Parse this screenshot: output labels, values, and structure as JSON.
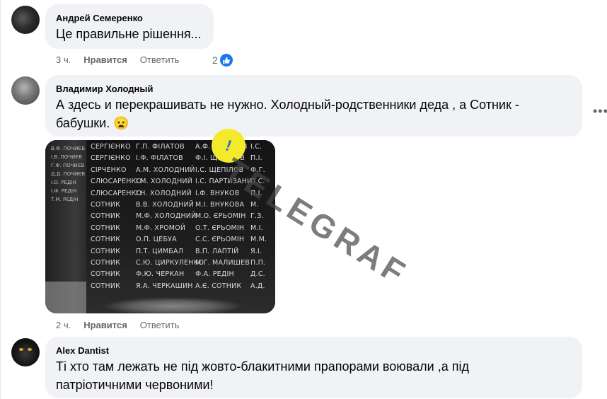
{
  "comments": [
    {
      "author": "Андрей Семеренко",
      "text": "Це правильне рішення...",
      "time": "3 ч.",
      "like_label": "Нравится",
      "reply_label": "Ответить",
      "reaction_count": "2"
    },
    {
      "author": "Владимир Холодный",
      "text_line1": "А здесь и перекрашивать не нужно. Холодный-родственники деда , а Сотник -",
      "text_line2": "бабушки. 😦",
      "time": "2 ч.",
      "like_label": "Нравится",
      "reply_label": "Ответить",
      "more_label": "•••",
      "photo": {
        "watermark": "TELEGRAF",
        "left_names": [
          "В.Ф. ПОЧИЄВ",
          "І.В. ПОЧИЄВ",
          "Г.Ф. ПОЧИЄВ",
          "Д.Д. ПОЧИЄВ",
          "І.О. РЕДІН",
          "І.Ф. РЕДІН",
          "Т.М. РЕДІН"
        ],
        "rows": [
          [
            "СЕРГІЄНКО",
            "Г.П. ФІЛАТОВ",
            "А.Ф. ЩЕПІЛОВ",
            "І.С."
          ],
          [
            "СЕРГІЄНКО",
            "І.Ф. ФІЛАТОВ",
            "Ф.І. ЩЕПІЛОВ",
            "П.І."
          ],
          [
            "СІРЧЕНКО",
            "А.М. ХОЛОДНИЙ",
            "І.С. ЩЕПІЛОВ",
            "Ф.Г."
          ],
          [
            "СЛЮСАРЕНКО",
            "І.М. ХОЛОДНИЙ",
            "І.С. ПАРТИЗАНИ",
            "П.С."
          ],
          [
            "СЛЮСАРЕНКО",
            "І.Н. ХОЛОДНИЙ",
            "І.Ф. ВНУКОВ",
            "П.І."
          ],
          [
            "СОТНИК",
            "В.В. ХОЛОДНИЙ",
            "М.І. ВНУКОВА",
            "М."
          ],
          [
            "СОТНИК",
            "М.Ф. ХОЛОДНИЙ",
            "М.О. ЄРЬОМІН",
            "Г.З."
          ],
          [
            "СОТНИК",
            "М.Ф. ХРОМОЙ",
            "О.Т. ЄРЬОМІН",
            "М.І."
          ],
          [
            "СОТНИК",
            "О.П. ЦЕБУА",
            "С.С. ЄРЬОМІН",
            "М.М."
          ],
          [
            "СОТНИК",
            "П.Т. ЦИМБАЛ",
            "В.П. ЛАПТІЙ",
            "Я.І."
          ],
          [
            "СОТНИК",
            "С.Ю. ЦИРКУЛЕНКО",
            "М.Г. МАЛИШЕВ",
            "П.П."
          ],
          [
            "СОТНИК",
            "Ф.Ю. ЧЕРКАН",
            "Ф.А. РЕДІН",
            "Д.С."
          ],
          [
            "СОТНИК",
            "Я.А. ЧЕРКАШИН",
            "А.Є. СОТНИК",
            "А.Д."
          ]
        ]
      }
    },
    {
      "author": "Alex Dantist",
      "text_line1": "Ті хто там лежать не під жовто-блакитними прапорами воювали ,а під",
      "text_line2": "патріотичними червоними!"
    }
  ],
  "colors": {
    "bubble": "#f0f2f5",
    "meta": "#65676b",
    "like_blue": "#1877f2"
  }
}
